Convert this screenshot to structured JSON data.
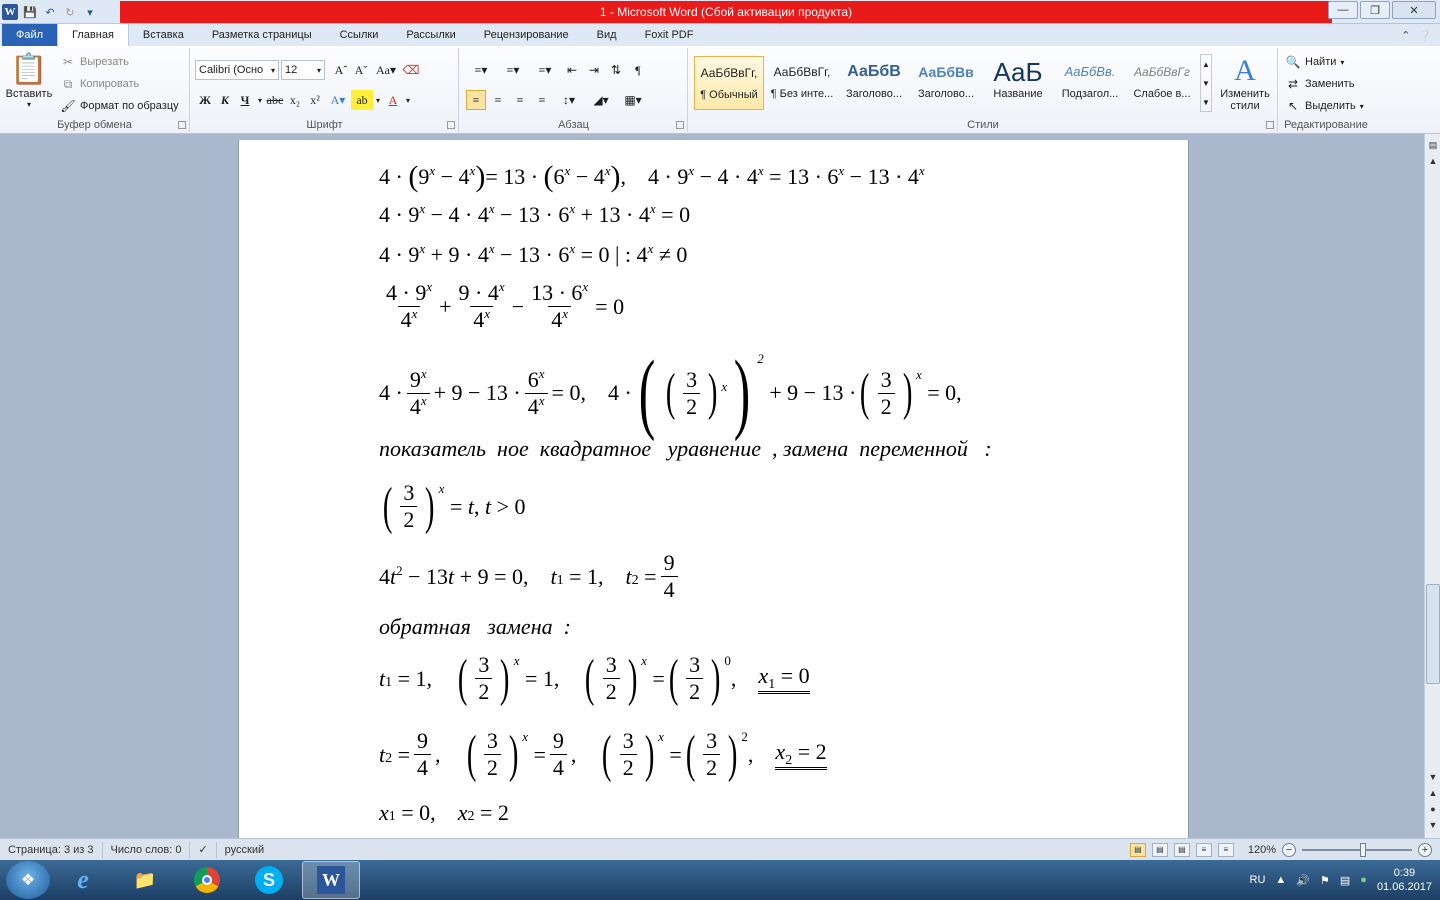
{
  "window": {
    "title": "1  -  Microsoft Word (Сбой активации продукта)",
    "title_bar_color": "#e81a1a"
  },
  "quick_access": {
    "icons": [
      "word-app-icon",
      "save-icon",
      "undo-icon",
      "redo-icon",
      "customize-icon"
    ]
  },
  "tabs": [
    {
      "label": "Файл"
    },
    {
      "label": "Главная"
    },
    {
      "label": "Вставка"
    },
    {
      "label": "Разметка страницы"
    },
    {
      "label": "Ссылки"
    },
    {
      "label": "Рассылки"
    },
    {
      "label": "Рецензирование"
    },
    {
      "label": "Вид"
    },
    {
      "label": "Foxit PDF"
    }
  ],
  "ribbon": {
    "clipboard": {
      "paste_label": "Вставить",
      "cut_label": "Вырезать",
      "copy_label": "Копировать",
      "format_painter_label": "Формат по образцу",
      "group_label": "Буфер обмена"
    },
    "font": {
      "font_name": "Calibri (Осно",
      "font_size": "12",
      "group_label": "Шрифт"
    },
    "paragraph": {
      "group_label": "Абзац"
    },
    "styles": {
      "items": [
        {
          "sample": "АаБбВвГг,",
          "name": "¶ Обычный"
        },
        {
          "sample": "АаБбВвГг,",
          "name": "¶ Без инте..."
        },
        {
          "sample": "АаБбВ",
          "name": "Заголово..."
        },
        {
          "sample": "АаБбВв",
          "name": "Заголово..."
        },
        {
          "sample": "АаБ",
          "name": "Название"
        },
        {
          "sample": "АаБбВв.",
          "name": "Подзагол..."
        },
        {
          "sample": "АаБбВвГг",
          "name": "Слабое в..."
        }
      ],
      "change_styles_label": "Изменить стили",
      "group_label": "Стили"
    },
    "editing": {
      "find_label": "Найти",
      "replace_label": "Заменить",
      "select_label": "Выделить",
      "group_label": "Редактирование"
    }
  },
  "document": {
    "text_line_1": "показатель  ное  квадратное   уравнение  , замена  переменной   :",
    "text_line_2": "обратная   замена  :"
  },
  "statusbar": {
    "page": "Страница: 3 из 3",
    "words": "Число слов: 0",
    "language": "русский",
    "zoom": "120%",
    "zoom_fraction": 0.53
  },
  "taskbar": {
    "lang": "RU",
    "time": "0:39",
    "date": "01.06.2017"
  }
}
